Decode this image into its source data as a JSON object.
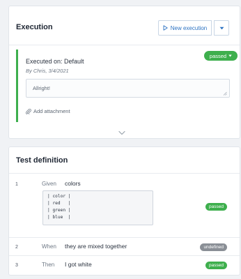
{
  "colors": {
    "passed": "#3eaf4d",
    "undefined": "#8a8f96",
    "accent": "#2b72c2"
  },
  "execution": {
    "title": "Execution",
    "new_execution_label": "New execution",
    "executed_on": "Executed on: Default",
    "executed_by": "By Chris, 3/4/2021",
    "status": "passed",
    "comment": "Allright!",
    "add_attachment_label": "Add attachment"
  },
  "test_definition": {
    "title": "Test definition",
    "steps": [
      {
        "number": "1",
        "keyword": "Given",
        "text": "colors",
        "status": "passed",
        "docstring": [
          "| color |",
          "| red   |",
          "| green |",
          "| blue  |"
        ]
      },
      {
        "number": "2",
        "keyword": "When",
        "text": "they are mixed together",
        "status": "undefined"
      },
      {
        "number": "3",
        "keyword": "Then",
        "text": "I got white",
        "status": "passed"
      }
    ]
  }
}
